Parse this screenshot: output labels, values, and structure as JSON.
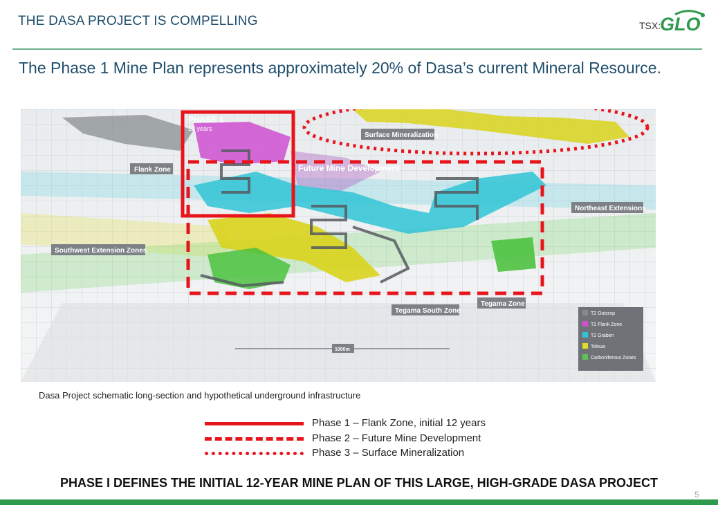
{
  "header": {
    "title": "THE DASA PROJECT IS COMPELLING"
  },
  "logo": {
    "prefix": "TSX:",
    "name": "GLO"
  },
  "subtitle": "The Phase 1 Mine Plan represents approximately 20% of Dasa’s current Mineral Resource.",
  "diagram": {
    "phase1_title": "PHASE 1",
    "phase1_years": "12 years",
    "zone_labels": {
      "surface_mineralization": "Surface Mineralization",
      "flank_zone": "Flank Zone",
      "future_mine_development": "Future Mine Development",
      "northeast_extensions": "Northeast Extensions",
      "southwest_extension_zones": "Southwest Extension Zones",
      "tegama_south_zone": "Tegama South Zone",
      "tegama_zone": "Tegama Zone"
    },
    "scale_bar": "1000m",
    "key": [
      {
        "label": "T2 Outcrop",
        "color": "#8a8a8a"
      },
      {
        "label": "T2 Flank Zone",
        "color": "#d14fd1"
      },
      {
        "label": "T2 Graben",
        "color": "#2fc4d6"
      },
      {
        "label": "Teloua",
        "color": "#e0dc2a"
      },
      {
        "label": "Carboniferous Zones",
        "color": "#5bc452"
      }
    ]
  },
  "caption": "Dasa Project schematic long-section and hypothetical underground infrastructure",
  "legend": [
    {
      "style": "solid",
      "label": "Phase 1 – Flank Zone, initial 12 years"
    },
    {
      "style": "dashed",
      "label": "Phase 2 – Future Mine Development"
    },
    {
      "style": "dotted",
      "label": "Phase 3 – Surface Mineralization"
    }
  ],
  "conclusion": "PHASE I DEFINES THE INITIAL 12-YEAR MINE PLAN OF THIS LARGE, HIGH-GRADE DASA PROJECT",
  "page_number": "5",
  "colors": {
    "accent_red": "#e8141b",
    "brand_green": "#2e9a4e",
    "title_blue": "#1e4d6b"
  }
}
